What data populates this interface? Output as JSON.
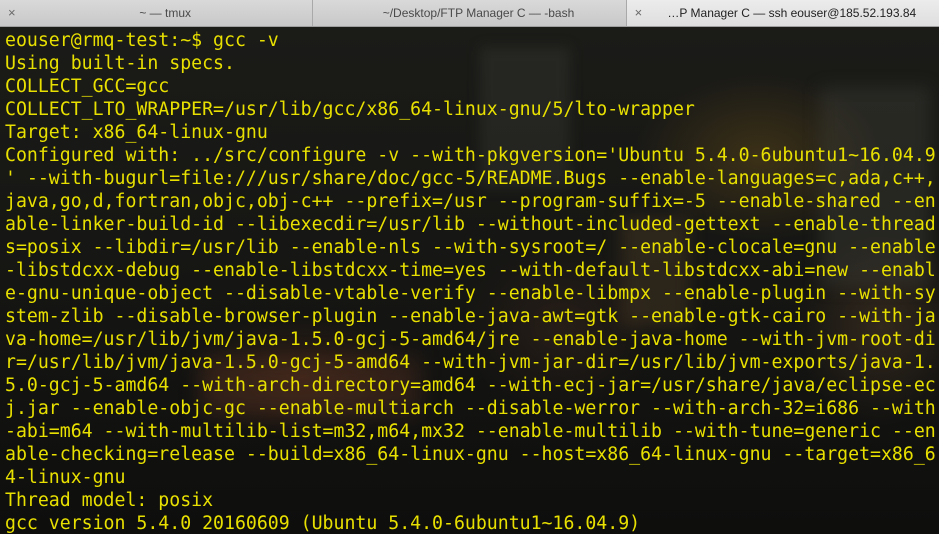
{
  "tabs": [
    {
      "close": "×",
      "label": "~ — tmux",
      "active": false
    },
    {
      "close": "",
      "label": "~/Desktop/FTP Manager C — -bash",
      "active": false
    },
    {
      "close": "×",
      "label": "…P Manager C — ssh eouser@185.52.193.84",
      "active": true
    }
  ],
  "terminal": {
    "text_color": "#e8e000",
    "lines": [
      "eouser@rmq-test:~$ gcc -v",
      "Using built-in specs.",
      "COLLECT_GCC=gcc",
      "COLLECT_LTO_WRAPPER=/usr/lib/gcc/x86_64-linux-gnu/5/lto-wrapper",
      "Target: x86_64-linux-gnu",
      "Configured with: ../src/configure -v --with-pkgversion='Ubuntu 5.4.0-6ubuntu1~16.04.9",
      "' --with-bugurl=file:///usr/share/doc/gcc-5/README.Bugs --enable-languages=c,ada,c++,",
      "java,go,d,fortran,objc,obj-c++ --prefix=/usr --program-suffix=-5 --enable-shared --en",
      "able-linker-build-id --libexecdir=/usr/lib --without-included-gettext --enable-thread",
      "s=posix --libdir=/usr/lib --enable-nls --with-sysroot=/ --enable-clocale=gnu --enable",
      "-libstdcxx-debug --enable-libstdcxx-time=yes --with-default-libstdcxx-abi=new --enabl",
      "e-gnu-unique-object --disable-vtable-verify --enable-libmpx --enable-plugin --with-sy",
      "stem-zlib --disable-browser-plugin --enable-java-awt=gtk --enable-gtk-cairo --with-ja",
      "va-home=/usr/lib/jvm/java-1.5.0-gcj-5-amd64/jre --enable-java-home --with-jvm-root-di",
      "r=/usr/lib/jvm/java-1.5.0-gcj-5-amd64 --with-jvm-jar-dir=/usr/lib/jvm-exports/java-1.",
      "5.0-gcj-5-amd64 --with-arch-directory=amd64 --with-ecj-jar=/usr/share/java/eclipse-ec",
      "j.jar --enable-objc-gc --enable-multiarch --disable-werror --with-arch-32=i686 --with",
      "-abi=m64 --with-multilib-list=m32,m64,mx32 --enable-multilib --with-tune=generic --en",
      "able-checking=release --build=x86_64-linux-gnu --host=x86_64-linux-gnu --target=x86_6",
      "4-linux-gnu",
      "Thread model: posix",
      "gcc version 5.4.0 20160609 (Ubuntu 5.4.0-6ubuntu1~16.04.9)"
    ]
  }
}
